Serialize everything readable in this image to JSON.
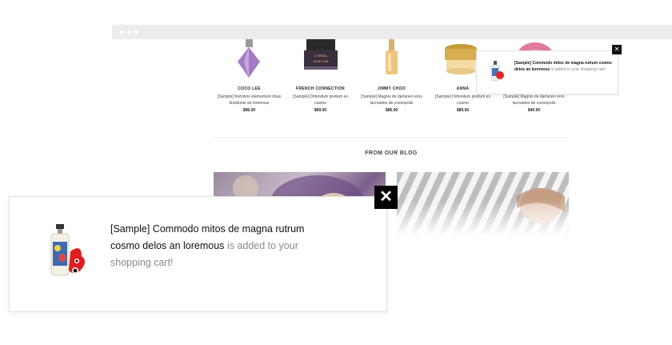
{
  "products": [
    {
      "name": "COCO LEE",
      "desc": "[Sample] Nominos elementum dous tincidunts an loremous",
      "price": "$96.00"
    },
    {
      "name": "FRENCH CONNECTION",
      "desc": "[Sample] Dirtendum pretium es cosmo",
      "price": "$69.00"
    },
    {
      "name": "JIMMY CHOO",
      "desc": "[Sample] Magnis de dartunen eros lacroades de cosnopolis",
      "price": "$86.00"
    },
    {
      "name": "ANNA",
      "desc": "[Sample] Dirtendum pretium es cosmo",
      "price": "$89.00"
    },
    {
      "name": "",
      "desc": "[Sample] Magnis de dartunen eros lacroades de cosnopolis",
      "price": "$40.00"
    }
  ],
  "blog": {
    "title": "FROM OUR BLOG"
  },
  "mini_popup": {
    "product": "[Sample] Commodo mitos de magna rutrum cosmo delos an loremous",
    "message": " is added to your shopping cart!"
  },
  "popup": {
    "product": "[Sample] Commodo mitos de magna rutrum cosmo delos an loremous",
    "message": " is added to your shopping cart!",
    "close_label": "✕"
  },
  "colors": {
    "accent": "#000000",
    "bar": "#ececec"
  }
}
